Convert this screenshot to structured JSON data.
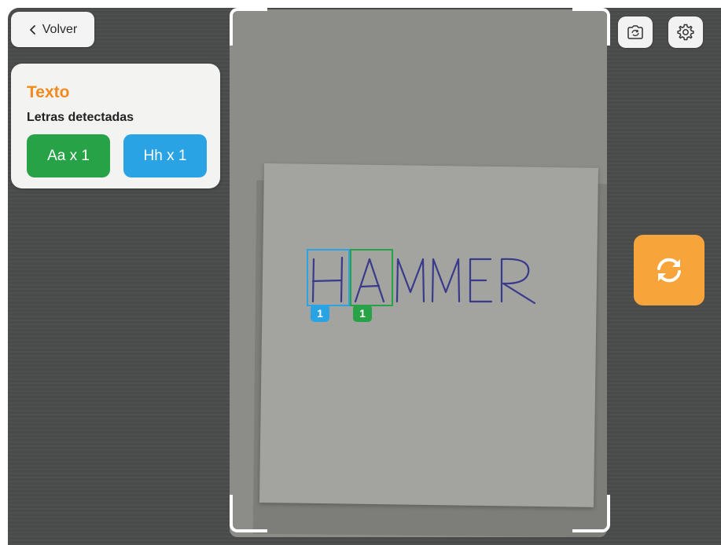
{
  "nav": {
    "back_label": "Volver",
    "back_icon": "chevron-left-icon"
  },
  "panel": {
    "title": "Texto",
    "subtitle": "Letras detectadas",
    "chips": [
      {
        "label": "Aa x 1",
        "color": "#27a246"
      },
      {
        "label": "Hh x 1",
        "color": "#2aa3e4"
      }
    ]
  },
  "camera": {
    "handwritten_word": "HAMMER",
    "detections": [
      {
        "letter": "H",
        "count": "1",
        "color": "#2aa3e4"
      },
      {
        "letter": "A",
        "count": "1",
        "color": "#27a246"
      }
    ]
  },
  "toolbar": {
    "switch_camera_icon": "camera-switch-icon",
    "settings_icon": "gear-icon",
    "reset_icon": "refresh-icon"
  },
  "colors": {
    "accent": "#f28a1e",
    "reset_button": "#f7a53a",
    "ink": "#3a3a8c"
  }
}
